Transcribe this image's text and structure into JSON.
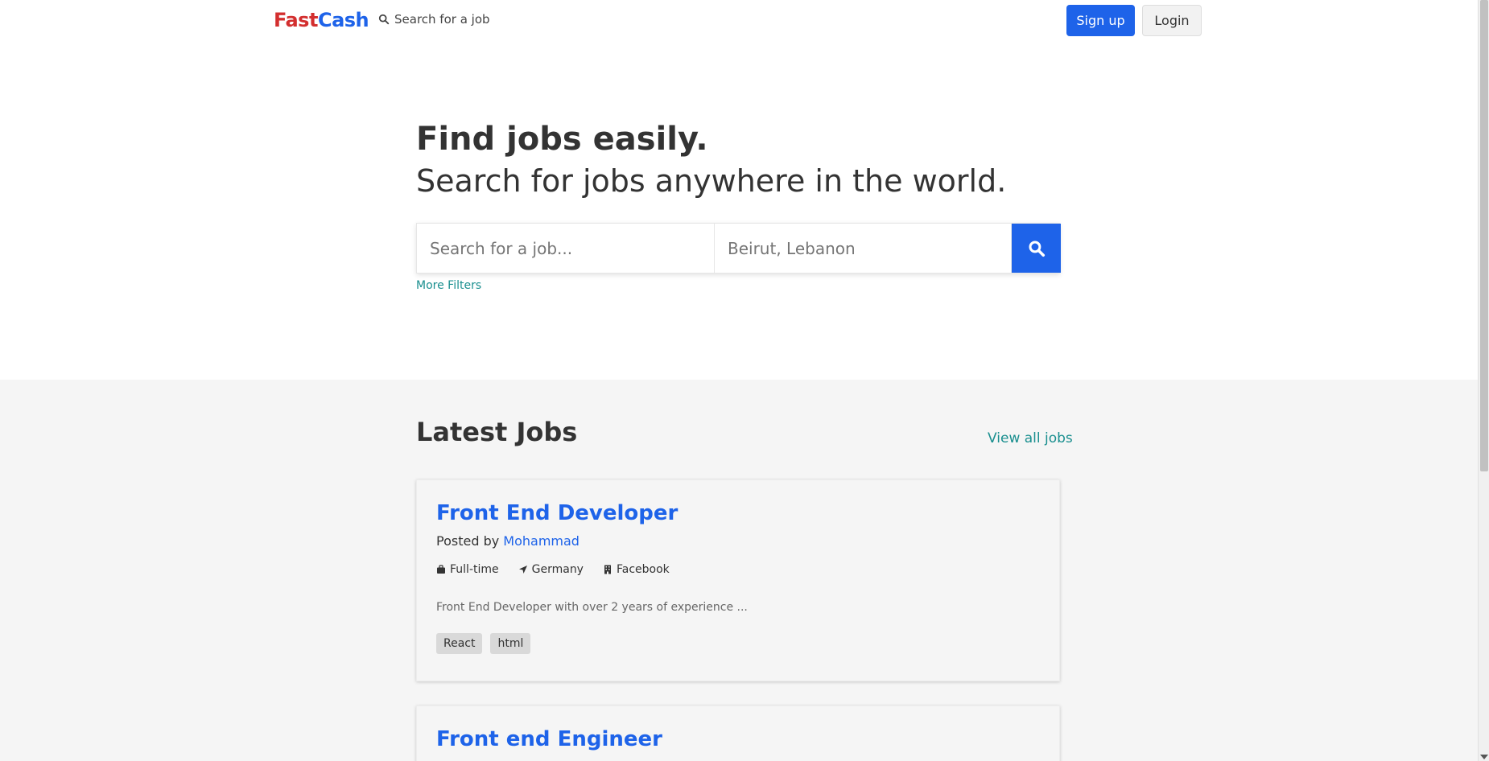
{
  "nav": {
    "brand_part1": "Fast",
    "brand_part2": "Cash",
    "search_link": "Search for a job",
    "signup": "Sign up",
    "login": "Login"
  },
  "hero": {
    "title": "Find jobs easily.",
    "subtitle": "Search for jobs anywhere in the world.",
    "job_placeholder": "Search for a job...",
    "location_placeholder": "Beirut, Lebanon",
    "more_filters": "More Filters"
  },
  "latest": {
    "title": "Latest Jobs",
    "view_all": "View all jobs",
    "jobs": [
      {
        "title": "Front End Developer",
        "posted_prefix": "Posted by",
        "author": "Mohammad",
        "type": "Full-time",
        "location": "Germany",
        "company": "Facebook",
        "description": "Front End Developer with over 2 years of experience ...",
        "tags": [
          "React",
          "html"
        ]
      },
      {
        "title": "Front end Engineer"
      }
    ]
  },
  "colors": {
    "primary": "#1e63e9",
    "brand_red": "#d32f2f",
    "link_teal": "#1a8f8f",
    "section_bg": "#f5f5f5"
  }
}
